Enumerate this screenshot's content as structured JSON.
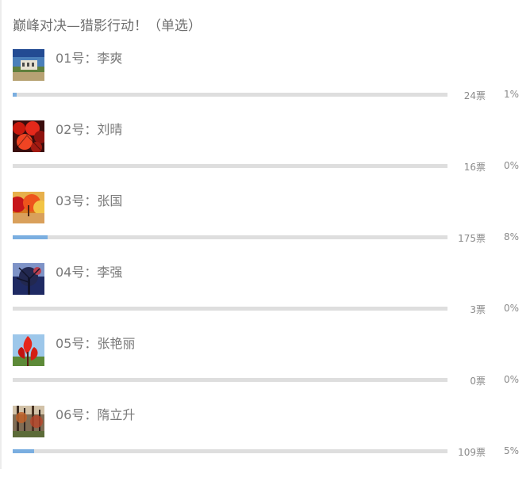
{
  "poll": {
    "title": "巅峰对决—猎影行动！（单选）",
    "options": [
      {
        "label": "01号：李爽",
        "votes": "24票",
        "percent": "1%",
        "progress": 0.01,
        "thumbnail": "photo-house"
      },
      {
        "label": "02号：刘晴",
        "votes": "16票",
        "percent": "0%",
        "progress": 0.0,
        "thumbnail": "photo-red-leaves"
      },
      {
        "label": "03号：张国",
        "votes": "175票",
        "percent": "8%",
        "progress": 0.08,
        "thumbnail": "photo-autumn-forest"
      },
      {
        "label": "04号：李强",
        "votes": "3票",
        "percent": "0%",
        "progress": 0.0,
        "thumbnail": "photo-dark-tree"
      },
      {
        "label": "05号：张艳丽",
        "votes": "0票",
        "percent": "0%",
        "progress": 0.0,
        "thumbnail": "photo-red-leaf-sky"
      },
      {
        "label": "06号：隋立升",
        "votes": "109票",
        "percent": "5%",
        "progress": 0.05,
        "thumbnail": "photo-trees"
      }
    ]
  },
  "colors": {
    "progress_fill": "#7aaee0",
    "progress_track": "#dedede",
    "title_text": "#6f6f6f",
    "muted_text": "#8a8a8a"
  }
}
